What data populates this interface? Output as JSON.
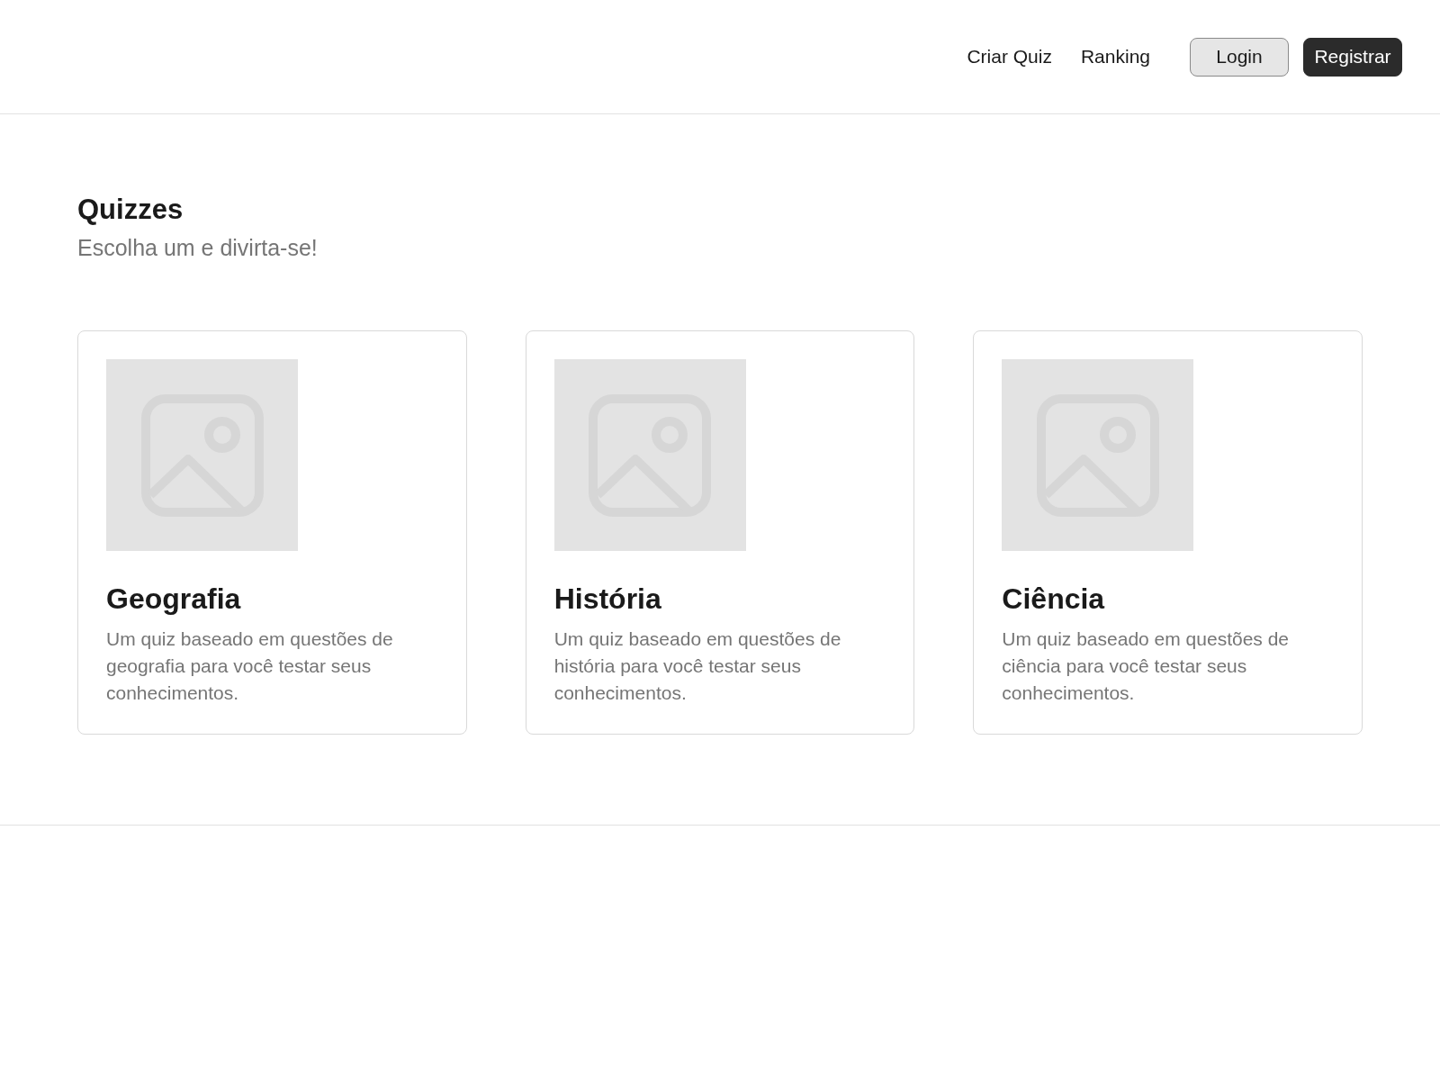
{
  "nav": {
    "links": [
      "Criar Quiz",
      "Ranking"
    ],
    "buttons": [
      {
        "label": "Login",
        "kind": "secondary"
      },
      {
        "label": "Registrar",
        "kind": "primary"
      }
    ]
  },
  "heading": {
    "title": "Quizzes",
    "subtitle": "Escolha um e divirta-se!"
  },
  "cards": [
    {
      "title": "Geografia",
      "description": "Um quiz baseado em questões de geografia para você testar seus conhecimentos."
    },
    {
      "title": "História",
      "description": "Um quiz baseado em questões de história para você testar seus conhecimentos."
    },
    {
      "title": "Ciência",
      "description": "Um quiz baseado em questões de ciência para você testar seus conhecimentos."
    }
  ]
}
